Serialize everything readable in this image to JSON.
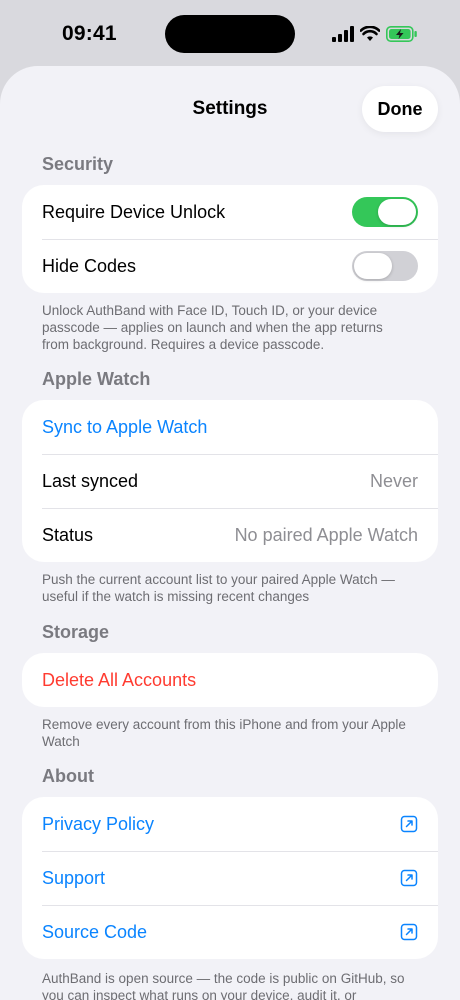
{
  "status_bar": {
    "time": "09:41"
  },
  "nav": {
    "title": "Settings",
    "done_label": "Done"
  },
  "security": {
    "header": "Security",
    "require_unlock_label": "Require Device Unlock",
    "require_unlock_on": true,
    "hide_codes_label": "Hide Codes",
    "hide_codes_on": false,
    "footer": "Unlock AuthBand with Face ID, Touch ID, or your device passcode — applies on launch and when the app returns from background. Requires a device passcode."
  },
  "watch": {
    "header": "Apple Watch",
    "sync_label": "Sync to Apple Watch",
    "last_synced_label": "Last synced",
    "last_synced_value": "Never",
    "status_label": "Status",
    "status_value": "No paired Apple Watch",
    "footer": "Push the current account list to your paired Apple Watch — useful if the watch is missing recent changes"
  },
  "storage": {
    "header": "Storage",
    "delete_label": "Delete All Accounts",
    "footer": "Remove every account from this iPhone and from your Apple Watch"
  },
  "about": {
    "header": "About",
    "privacy_label": "Privacy Policy",
    "support_label": "Support",
    "source_label": "Source Code",
    "footer": "AuthBand is open source — the code is public on GitHub, so you can inspect what runs on your device, audit it, or"
  },
  "colors": {
    "accent": "#0a84ff",
    "toggle_on": "#34c759",
    "destructive": "#ff3b30",
    "battery_green": "#34c759"
  },
  "icons": {
    "signal": "cellular-signal-icon",
    "wifi": "wifi-icon",
    "battery": "battery-charging-icon",
    "external": "external-link-icon"
  }
}
